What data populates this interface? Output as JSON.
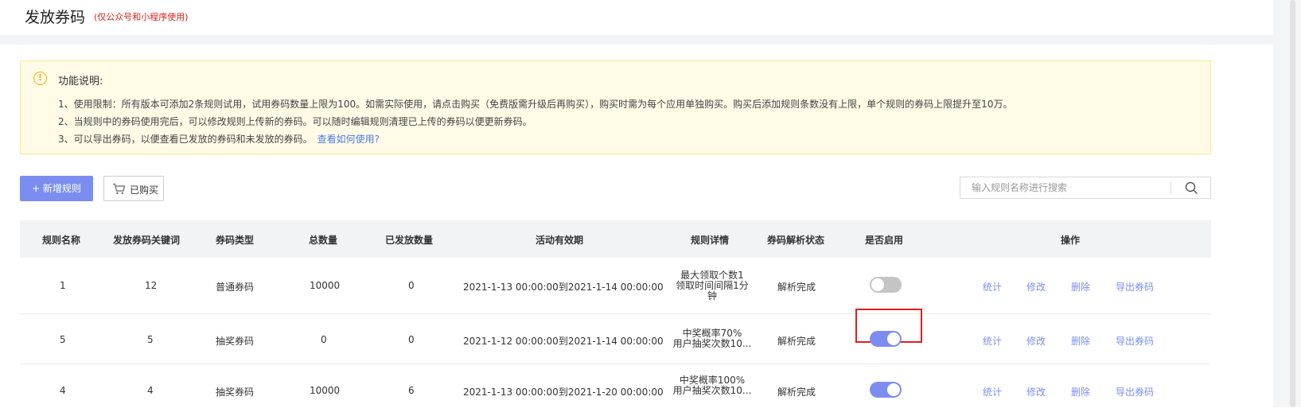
{
  "header": {
    "title": "发放券码",
    "subtitle": "(仅公众号和小程序使用)"
  },
  "notice": {
    "title": "功能说明:",
    "line1": "1、使用限制：所有版本可添加2条规则试用，试用券码数量上限为100。如需实际使用，请点击购买（免费版需升级后再购买），购买时需为每个应用单独购买。购买后添加规则条数没有上限，单个规则的券码上限提升至10万。",
    "line2": "2、当规则中的券码使用完后，可以修改规则上传新的券码。可以随时编辑规则清理已上传的券码以便更新券码。",
    "line3": "3、可以导出券码，以便查看已发放的券码和未发放的券码。",
    "link": "查看如何使用?"
  },
  "toolbar": {
    "add_label": "+ 新增规则",
    "bought_label": "已购买",
    "search_placeholder": "输入规则名称进行搜索"
  },
  "table": {
    "headers": {
      "name": "规则名称",
      "keyword": "发放券码关键词",
      "type": "券码类型",
      "total": "总数量",
      "issued": "已发放数量",
      "period": "活动有效期",
      "detail": "规则详情",
      "status": "券码解析状态",
      "enabled": "是否启用",
      "ops": "操作"
    },
    "rows": [
      {
        "name": "1",
        "keyword": "12",
        "type": "普通券码",
        "total": "10000",
        "issued": "0",
        "period": "2021-1-13 00:00:00到2021-1-14 00:00:00",
        "detail_lines": [
          "最大领取个数1",
          "领取时间间隔1分",
          "钟"
        ],
        "status": "解析完成",
        "enabled": false
      },
      {
        "name": "5",
        "keyword": "5",
        "type": "抽奖券码",
        "total": "0",
        "issued": "0",
        "period": "2021-1-12 00:00:00到2021-1-14 00:00:00",
        "detail_lines": [
          "中奖概率70%",
          "用户抽奖次数10..."
        ],
        "status": "解析完成",
        "enabled": true
      },
      {
        "name": "4",
        "keyword": "4",
        "type": "抽奖券码",
        "total": "10000",
        "issued": "6",
        "period": "2021-1-13 00:00:00到2021-1-20 00:00:00",
        "detail_lines": [
          "中奖概率100%",
          "用户抽奖次数10..."
        ],
        "status": "解析完成",
        "enabled": true
      }
    ],
    "ops": {
      "stats": "统计",
      "edit": "修改",
      "delete": "删除",
      "export": "导出券码"
    }
  }
}
